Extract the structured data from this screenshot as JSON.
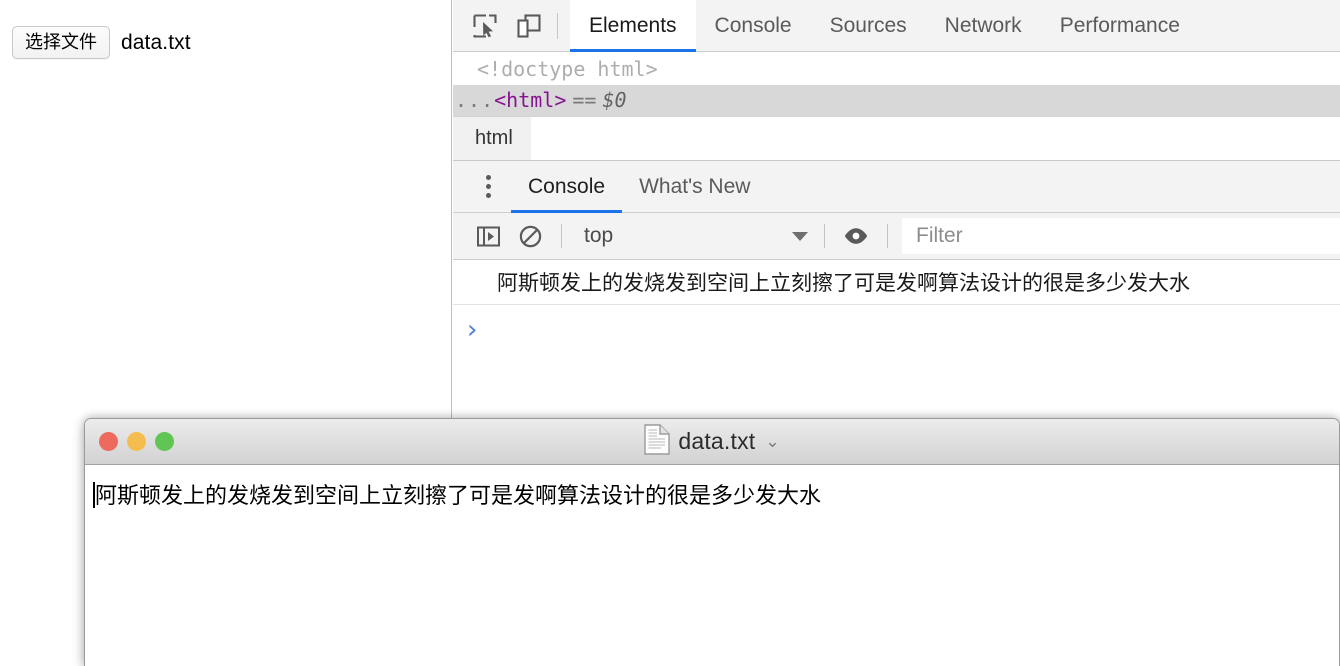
{
  "page": {
    "file_input": {
      "button_label": "选择文件",
      "file_name": "data.txt"
    }
  },
  "devtools": {
    "toolbar_icons": [
      {
        "name": "inspect-element-icon",
        "label": "Inspect element"
      },
      {
        "name": "device-toolbar-icon",
        "label": "Toggle device toolbar"
      }
    ],
    "tabs": [
      {
        "label": "Elements",
        "active": true
      },
      {
        "label": "Console",
        "active": false
      },
      {
        "label": "Sources",
        "active": false
      },
      {
        "label": "Network",
        "active": false
      },
      {
        "label": "Performance",
        "active": false
      }
    ],
    "dom_tree": {
      "doctype": "<!doctype html>",
      "ellipsis": "...",
      "open_bracket": "<",
      "tag_name": "html",
      "close_bracket": ">",
      "equals": "==",
      "selected_ref": "$0"
    },
    "breadcrumb": {
      "items": [
        "html"
      ]
    },
    "drawer": {
      "tabs": [
        {
          "label": "Console",
          "active": true
        },
        {
          "label": "What's New",
          "active": false
        }
      ],
      "toolbar": {
        "sidebar_icon": "console-sidebar-icon",
        "clear_icon": "clear-console-icon",
        "context_value": "top",
        "eye_icon": "live-expression-eye-icon",
        "filter_placeholder": "Filter",
        "filter_value": ""
      },
      "console": {
        "messages": [
          "阿斯顿发上的发烧发到空间上立刻擦了可是发啊算法设计的很是多少发大水"
        ],
        "prompt_symbol": "›",
        "prompt_value": ""
      }
    }
  },
  "text_editor_window": {
    "title": "data.txt",
    "title_caret": "⌄",
    "document_icon": "text-document-icon",
    "traffic_lights": [
      {
        "name": "close-button",
        "color": "#ee6a5f"
      },
      {
        "name": "minimize-button",
        "color": "#f5bd4f"
      },
      {
        "name": "zoom-button",
        "color": "#61c554"
      }
    ],
    "content_lines": [
      "阿斯顿发上的发烧发到空间上立刻擦了可是发啊算法设计的很是多少发大水"
    ]
  },
  "colors": {
    "accent_blue": "#1a73e8",
    "prompt_blue": "#4d7fd4",
    "tag_purple": "#881391"
  }
}
